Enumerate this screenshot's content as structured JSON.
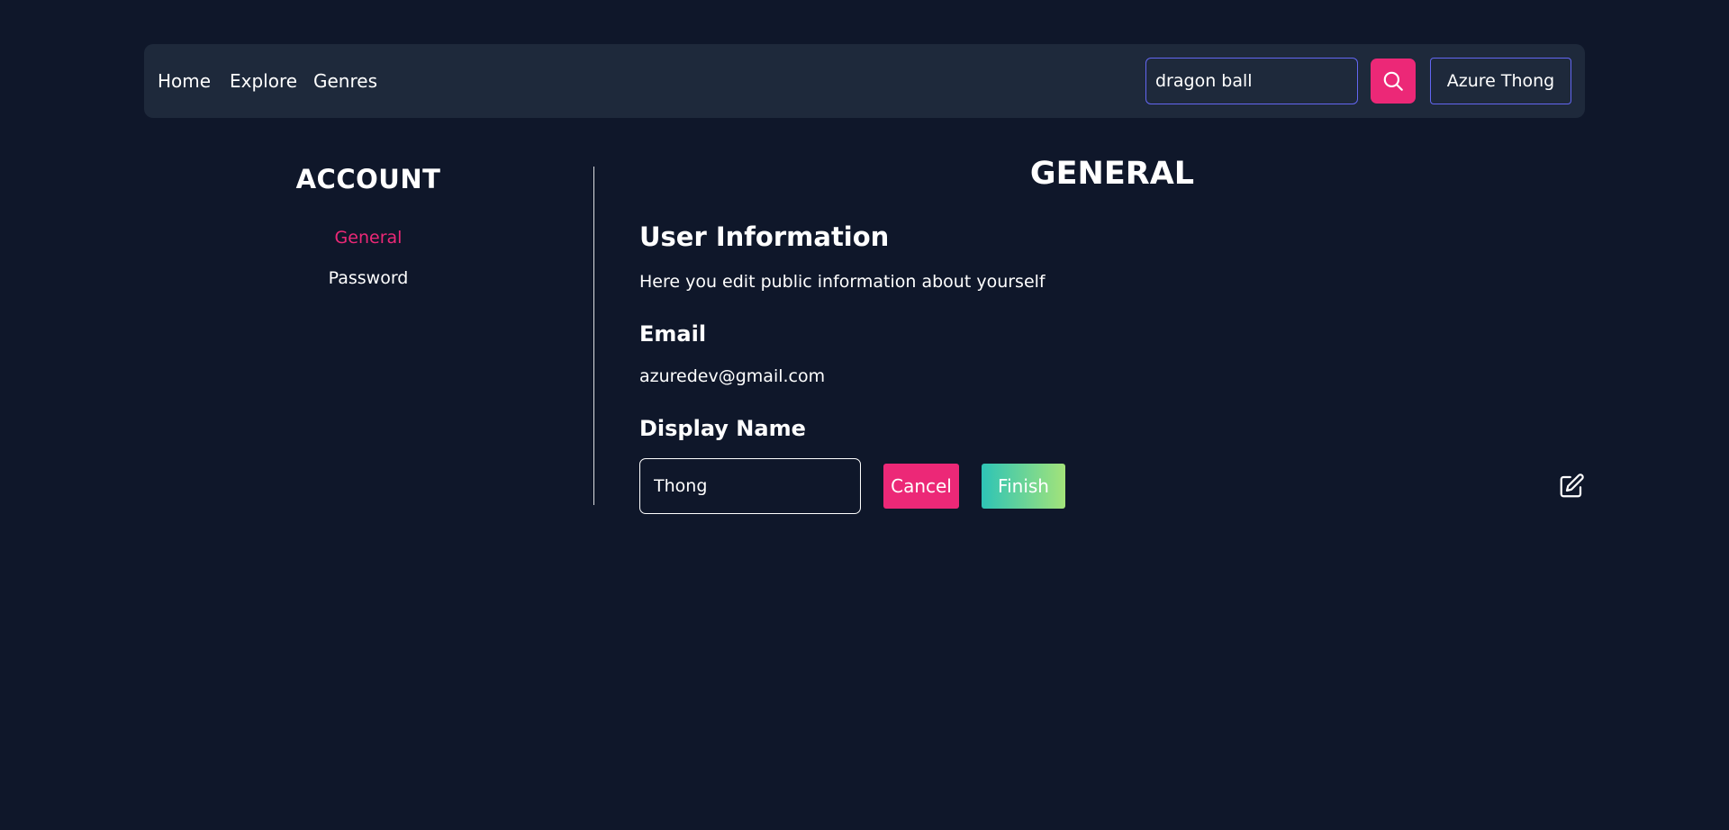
{
  "nav": {
    "links": [
      "Home",
      "Explore",
      "Genres"
    ],
    "search_value": "dragon ball",
    "user_label": "Azure Thong"
  },
  "sidebar": {
    "title": "ACCOUNT",
    "items": [
      {
        "label": "General",
        "active": true
      },
      {
        "label": "Password",
        "active": false
      }
    ]
  },
  "main": {
    "page_title": "GENERAL",
    "section_title": "User Information",
    "section_desc": "Here you edit public information about yourself",
    "email_label": "Email",
    "email_value": "azuredev@gmail.com",
    "display_name_label": "Display Name",
    "display_name_value": "Thong",
    "cancel_label": "Cancel",
    "finish_label": "Finish"
  },
  "colors": {
    "background": "#0f172a",
    "navbar": "#1e293b",
    "accent_pink": "#ec2877",
    "input_border": "#6366f1",
    "finish_gradient_start": "#2ec4b6",
    "finish_gradient_end": "#a3e37a"
  },
  "icons": {
    "search": "search-icon",
    "edit": "edit-icon"
  }
}
